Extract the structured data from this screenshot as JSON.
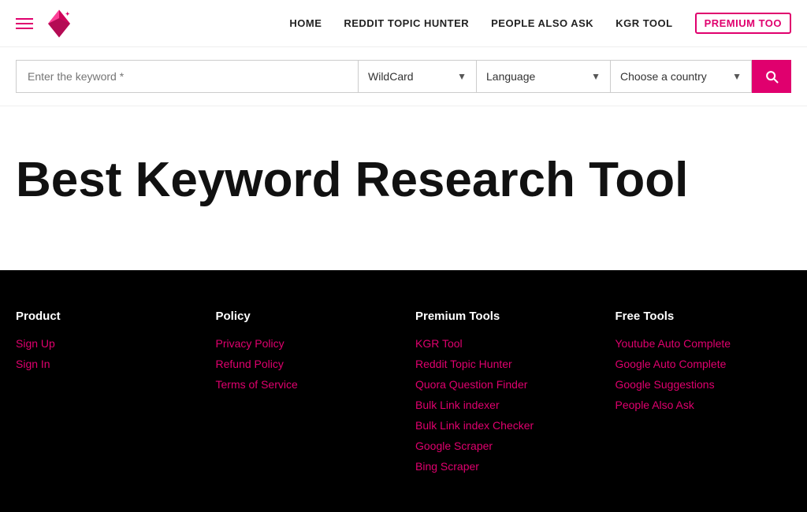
{
  "header": {
    "nav": [
      {
        "label": "HOME",
        "id": "home"
      },
      {
        "label": "REDDIT TOPIC HUNTER",
        "id": "reddit-topic-hunter"
      },
      {
        "label": "PEOPLE ALSO ASK",
        "id": "people-also-ask"
      },
      {
        "label": "KGR TOOL",
        "id": "kgr-tool"
      },
      {
        "label": "PREMIUM TOO",
        "id": "premium-tool"
      }
    ]
  },
  "searchbar": {
    "keyword_placeholder": "Enter the keyword *",
    "wildcard_label": "WildCard",
    "language_label": "Language",
    "country_label": "Choose a country"
  },
  "hero": {
    "title": "Best Keyword Research Tool"
  },
  "footer": {
    "columns": [
      {
        "heading": "Product",
        "links": [
          {
            "label": "Sign Up",
            "id": "sign-up"
          },
          {
            "label": "Sign In",
            "id": "sign-in"
          }
        ]
      },
      {
        "heading": "Policy",
        "links": [
          {
            "label": "Privacy Policy",
            "id": "privacy-policy"
          },
          {
            "label": "Refund Policy",
            "id": "refund-policy"
          },
          {
            "label": "Terms of Service",
            "id": "terms-of-service"
          }
        ]
      },
      {
        "heading": "Premium Tools",
        "links": [
          {
            "label": "KGR Tool",
            "id": "kgr-tool"
          },
          {
            "label": "Reddit Topic Hunter",
            "id": "reddit-topic-hunter"
          },
          {
            "label": "Quora Question Finder",
            "id": "quora-question-finder"
          },
          {
            "label": "Bulk Link indexer",
            "id": "bulk-link-indexer"
          },
          {
            "label": "Bulk Link index Checker",
            "id": "bulk-link-index-checker"
          },
          {
            "label": "Google Scraper",
            "id": "google-scraper"
          },
          {
            "label": "Bing Scraper",
            "id": "bing-scraper"
          }
        ]
      },
      {
        "heading": "Free Tools",
        "links": [
          {
            "label": "Youtube Auto Complete",
            "id": "youtube-auto-complete"
          },
          {
            "label": "Google Auto Complete",
            "id": "google-auto-complete"
          },
          {
            "label": "Google Suggestions",
            "id": "google-suggestions"
          },
          {
            "label": "People Also Ask",
            "id": "people-also-ask"
          }
        ]
      }
    ]
  }
}
